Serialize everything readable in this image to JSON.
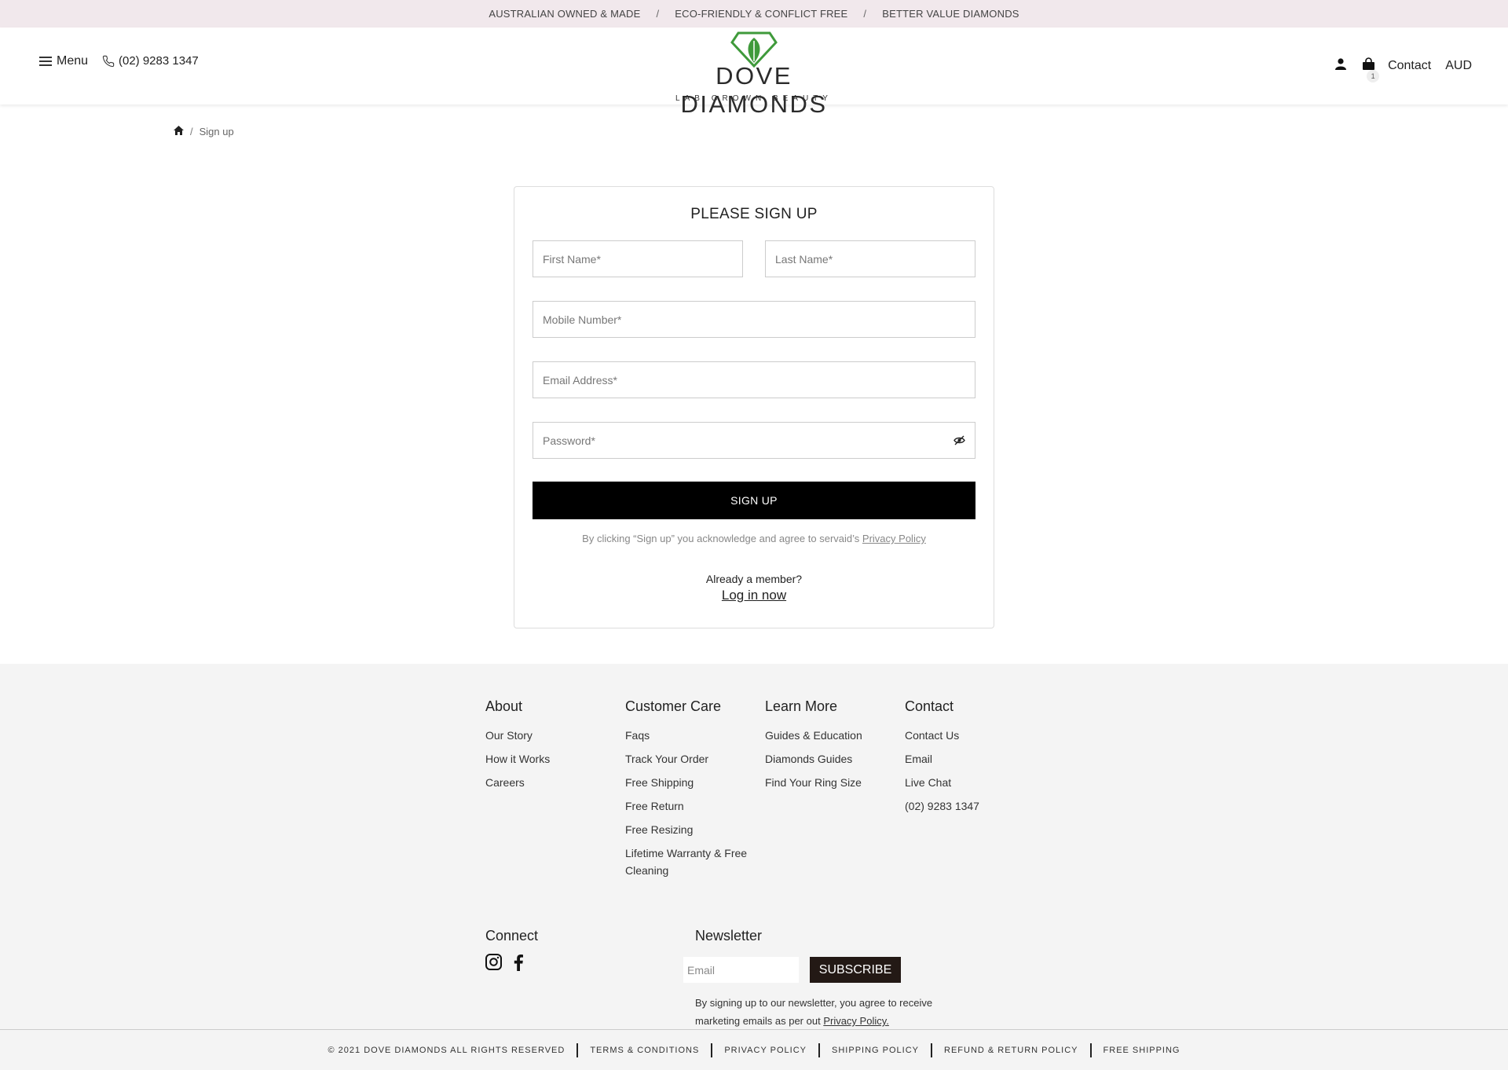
{
  "topbar": {
    "items": [
      "AUSTRALIAN OWNED & MADE",
      "ECO-FRIENDLY & CONFLICT FREE",
      "BETTER VALUE DIAMONDS"
    ],
    "separator": "/"
  },
  "header": {
    "menu_label": "Menu",
    "phone": "(02) 9283 1347",
    "logo_brand": "DOVE DIAMONDS",
    "logo_tagline": "LAB GROWN BEAUTY",
    "cart_count": "1",
    "contact_label": "Contact",
    "currency": "AUD",
    "logo_color": "#3f9a3b"
  },
  "breadcrumb": {
    "separator": "/",
    "current": "Sign up"
  },
  "signup": {
    "title": "PLEASE SIGN UP",
    "first_name_placeholder": "First Name*",
    "last_name_placeholder": "Last Name*",
    "mobile_placeholder": "Mobile Number*",
    "email_placeholder": "Email Address*",
    "password_placeholder": "Password*",
    "button_label": "SIGN UP",
    "agree_text": "By clicking “Sign up” you acknowledge and agree to servaid’s",
    "privacy_link": "Privacy Policy",
    "member_text": "Already a member?",
    "login_link": "Log in now"
  },
  "footer": {
    "columns": [
      {
        "title": "About",
        "links": [
          "Our Story",
          "How it Works",
          "Careers"
        ]
      },
      {
        "title": "Customer Care",
        "links": [
          "Faqs",
          "Track Your Order",
          "Free Shipping",
          "Free Return",
          "Free Resizing",
          "Lifetime Warranty & Free Cleaning"
        ]
      },
      {
        "title": "Learn More",
        "links": [
          "Guides & Education",
          "Diamonds Guides",
          "Find Your Ring Size"
        ]
      },
      {
        "title": "Contact",
        "links": [
          "Contact Us",
          "Email",
          "Live Chat",
          "(02) 9283 1347"
        ]
      }
    ],
    "connect_title": "Connect",
    "newsletter_title": "Newsletter",
    "newsletter_placeholder": "Email",
    "subscribe_label": "SUBSCRIBE",
    "newsletter_note": "By signing up to our newsletter, you agree to receive marketing emails as per out",
    "newsletter_privacy": "Privacy Policy."
  },
  "legal": {
    "copyright_mark": "©",
    "copyright": "2021 DOVE DIAMONDS ALL RIGHTS RESERVED",
    "links": [
      "TERMS & CONDITIONS",
      "PRIVACY POLICY",
      "SHIPPING POLICY",
      "REFUND & RETURN POLICY",
      "FREE SHIPPING"
    ]
  }
}
